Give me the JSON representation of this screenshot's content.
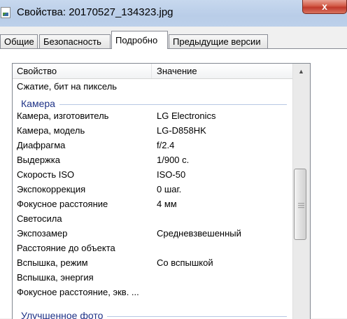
{
  "window": {
    "title": "Свойства: 20170527_134323.jpg",
    "close_label": "x"
  },
  "tabs": [
    {
      "label": "Общие"
    },
    {
      "label": "Безопасность"
    },
    {
      "label": "Подробно",
      "active": true
    },
    {
      "label": "Предыдущие версии"
    }
  ],
  "list": {
    "header": {
      "property": "Свойство",
      "value": "Значение"
    },
    "top_rows": [
      {
        "property": "Сжатие, бит на пиксель",
        "value": ""
      }
    ],
    "camera_group": {
      "title": "Камера",
      "rows": [
        {
          "property": "Камера, изготовитель",
          "value": "LG Electronics"
        },
        {
          "property": "Камера, модель",
          "value": "LG-D858HK"
        },
        {
          "property": "Диафрагма",
          "value": "f/2.4"
        },
        {
          "property": "Выдержка",
          "value": "1/900 с."
        },
        {
          "property": "Скорость ISO",
          "value": "ISO-50"
        },
        {
          "property": "Экспокоррекция",
          "value": "0 шаг."
        },
        {
          "property": "Фокусное расстояние",
          "value": "4 мм"
        },
        {
          "property": "Светосила",
          "value": ""
        },
        {
          "property": "Экспозамер",
          "value": "Средневзвешенный"
        },
        {
          "property": "Расстояние до объекта",
          "value": ""
        },
        {
          "property": "Вспышка, режим",
          "value": "Со вспышкой"
        },
        {
          "property": "Вспышка, энергия",
          "value": ""
        },
        {
          "property": "Фокусное расстояние, экв. ...",
          "value": ""
        }
      ]
    },
    "enhanced_group": {
      "title": "Улучшенное фото"
    }
  },
  "scrollbar": {
    "up_icon": "scroll-up-arrow",
    "grip_icon": "scroll-grip"
  },
  "colors": {
    "group_title": "#1e3287",
    "titlebar": "#bcd0ea",
    "close": "#c0392b"
  }
}
